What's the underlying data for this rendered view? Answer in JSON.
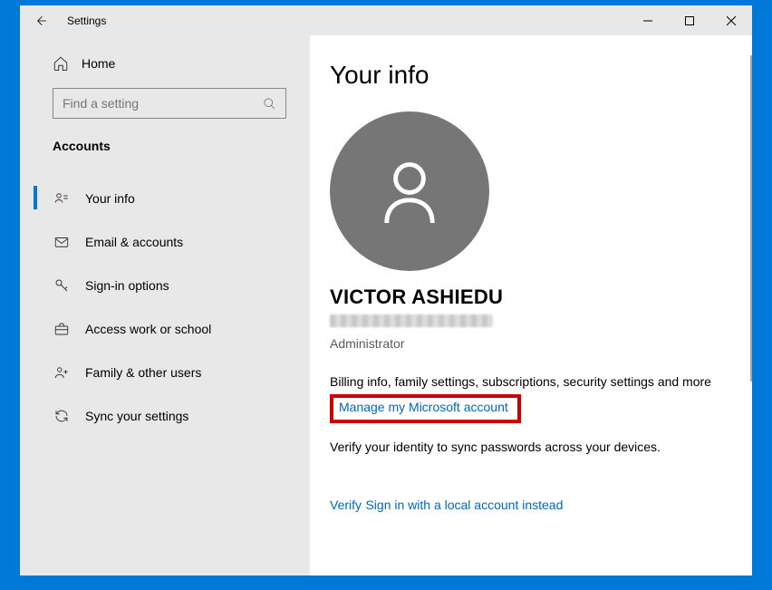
{
  "window": {
    "title": "Settings"
  },
  "sidebar": {
    "home_label": "Home",
    "search_placeholder": "Find a setting",
    "section_header": "Accounts",
    "items": [
      {
        "label": "Your info"
      },
      {
        "label": "Email & accounts"
      },
      {
        "label": "Sign-in options"
      },
      {
        "label": "Access work or school"
      },
      {
        "label": "Family & other users"
      },
      {
        "label": "Sync your settings"
      }
    ]
  },
  "content": {
    "heading": "Your info",
    "user_name": "VICTOR ASHIEDU",
    "role": "Administrator",
    "billing_text": "Billing info, family settings, subscriptions, security settings and more",
    "manage_link": "Manage my Microsoft account",
    "verify_text": "Verify your identity to sync passwords across your devices.",
    "verify_link": "Verify",
    "local_signin_link": "Sign in with a local account instead"
  }
}
